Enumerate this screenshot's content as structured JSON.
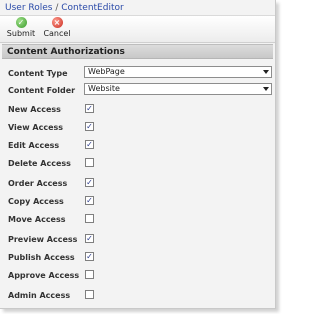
{
  "breadcrumb": {
    "part1": "User Roles",
    "separator": "/",
    "part2": "ContentEditor"
  },
  "toolbar": {
    "submit_label": "Submit",
    "cancel_label": "Cancel"
  },
  "section": {
    "title": "Content Authorizations"
  },
  "fields": {
    "content_type": {
      "label": "Content Type",
      "value": "WebPage"
    },
    "content_folder": {
      "label": "Content Folder",
      "value": "Website"
    }
  },
  "access": [
    {
      "label": "New Access",
      "checked": true
    },
    {
      "label": "View Access",
      "checked": true
    },
    {
      "label": "Edit Access",
      "checked": true
    },
    {
      "label": "Delete Access",
      "checked": false
    },
    {
      "label": "Order Access",
      "checked": true
    },
    {
      "label": "Copy Access",
      "checked": true
    },
    {
      "label": "Move Access",
      "checked": false
    },
    {
      "label": "Preview Access",
      "checked": true
    },
    {
      "label": "Publish Access",
      "checked": true
    },
    {
      "label": "Approve Access",
      "checked": false
    },
    {
      "label": "Admin Access",
      "checked": false
    }
  ],
  "colors": {
    "breadcrumb_link": "#2a4aa8",
    "submit_icon": "#3a9a2a",
    "cancel_icon": "#c92a1f"
  },
  "icons": {
    "submit": "check-circle-icon",
    "cancel": "x-circle-icon",
    "dropdown": "chevron-down-icon"
  }
}
